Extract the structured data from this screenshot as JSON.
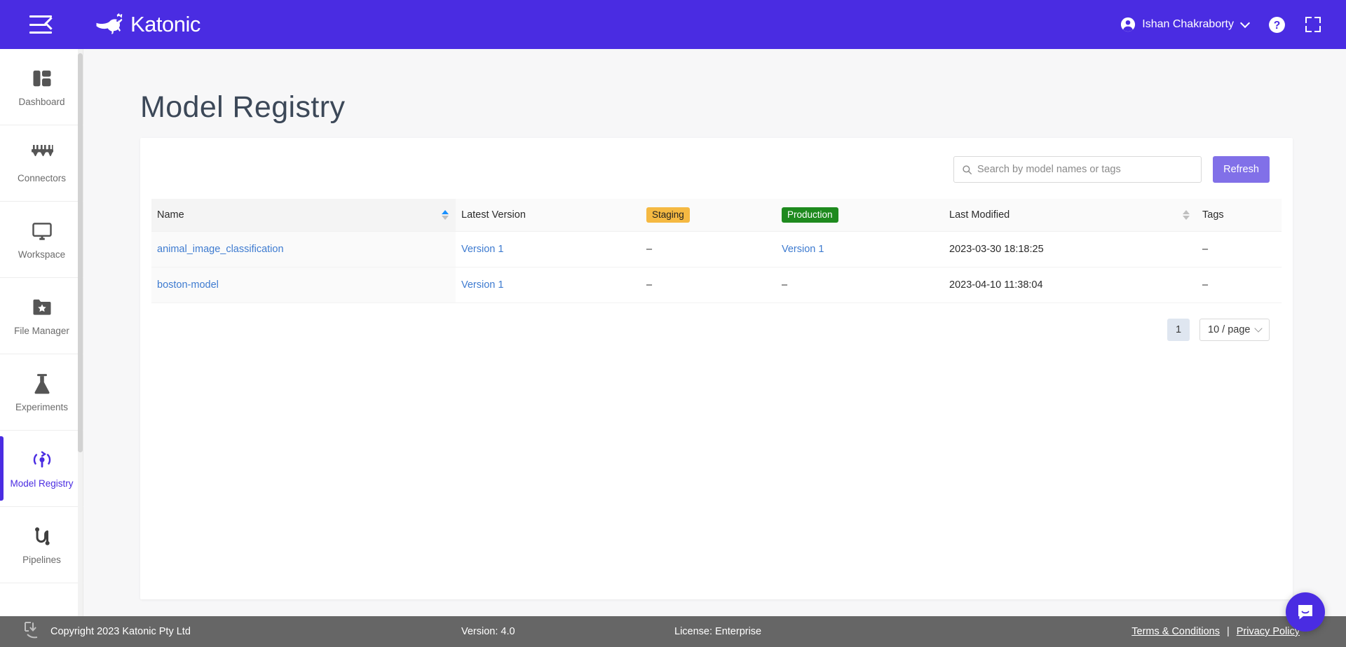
{
  "header": {
    "brand_name": "Katonic",
    "menu_icon": "hamburger-collapse-icon",
    "user_name": "Ishan Chakraborty",
    "help_icon": "question-mark-circle-icon",
    "fullscreen_icon": "expand-fullscreen-icon",
    "brand_color": "#4A2CE2"
  },
  "sidebar": {
    "items": [
      {
        "label": "Dashboard",
        "icon": "dashboard-grid-icon",
        "active": false
      },
      {
        "label": "Connectors",
        "icon": "connectors-plug-icon",
        "active": false
      },
      {
        "label": "Workspace",
        "icon": "monitor-icon",
        "active": false
      },
      {
        "label": "File Manager",
        "icon": "folder-star-icon",
        "active": false
      },
      {
        "label": "Experiments",
        "icon": "flask-icon",
        "active": false
      },
      {
        "label": "Model Registry",
        "icon": "model-registry-icon",
        "active": true
      },
      {
        "label": "Pipelines",
        "icon": "pipelines-icon",
        "active": false
      }
    ],
    "active_color": "#4A2CE2"
  },
  "main": {
    "title": "Model Registry",
    "search": {
      "placeholder": "Search by model names or tags",
      "value": "",
      "icon": "search-icon"
    },
    "refresh_label": "Refresh",
    "table": {
      "columns": [
        {
          "label": "Name",
          "sort": "asc",
          "badge": null
        },
        {
          "label": "Latest Version",
          "sort": null,
          "badge": null
        },
        {
          "label": "Staging",
          "sort": null,
          "badge": "staging"
        },
        {
          "label": "Production",
          "sort": null,
          "badge": "production"
        },
        {
          "label": "Last Modified",
          "sort": "none",
          "badge": null
        },
        {
          "label": "Tags",
          "sort": null,
          "badge": null
        }
      ],
      "rows": [
        {
          "name": "animal_image_classification",
          "latest_version": "Version 1",
          "staging": "–",
          "production": "Version 1",
          "last_modified": "2023-03-30 18:18:25",
          "tags": "–"
        },
        {
          "name": "boston-model",
          "latest_version": "Version 1",
          "staging": "–",
          "production": "–",
          "last_modified": "2023-04-10 11:38:04",
          "tags": "–"
        }
      ]
    },
    "pagination": {
      "current_page": "1",
      "page_size": "10 / page"
    }
  },
  "footer": {
    "copyright": "Copyright 2023 Katonic Pty Ltd",
    "version": "Version: 4.0",
    "license": "License: Enterprise",
    "terms": "Terms & Conditions",
    "separator": "|",
    "privacy": "Privacy Policy"
  },
  "chat": {
    "icon": "intercom-chat-bubble-icon"
  }
}
